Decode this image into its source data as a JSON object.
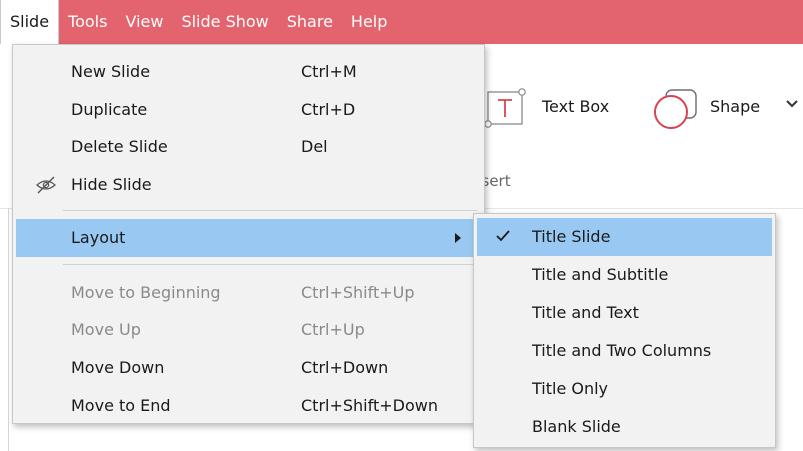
{
  "menubar": {
    "items": [
      {
        "label": "Slide",
        "active": true
      },
      {
        "label": "Tools"
      },
      {
        "label": "View"
      },
      {
        "label": "Slide Show"
      },
      {
        "label": "Share"
      },
      {
        "label": "Help"
      }
    ]
  },
  "ribbon": {
    "text_box_label": "Text Box",
    "shape_label": "Shape",
    "group_label": "nsert"
  },
  "slide_menu": {
    "items": [
      {
        "label": "New Slide",
        "shortcut": "Ctrl+M",
        "icon": "none"
      },
      {
        "label": "Duplicate",
        "shortcut": "Ctrl+D",
        "icon": "none"
      },
      {
        "label": "Delete Slide",
        "shortcut": "Del",
        "icon": "none"
      },
      {
        "label": "Hide Slide",
        "shortcut": "",
        "icon": "eye-slash-icon"
      },
      {
        "label": "Layout",
        "shortcut": "",
        "icon": "none",
        "has_submenu": true,
        "highlighted": true
      },
      {
        "label": "Move to Beginning",
        "shortcut": "Ctrl+Shift+Up",
        "disabled": true
      },
      {
        "label": "Move Up",
        "shortcut": "Ctrl+Up",
        "disabled": true
      },
      {
        "label": "Move Down",
        "shortcut": "Ctrl+Down"
      },
      {
        "label": "Move to End",
        "shortcut": "Ctrl+Shift+Down"
      }
    ]
  },
  "layout_submenu": {
    "items": [
      {
        "label": "Title Slide",
        "selected": true
      },
      {
        "label": "Title and Subtitle"
      },
      {
        "label": "Title and Text"
      },
      {
        "label": "Title and Two Columns"
      },
      {
        "label": "Title Only"
      },
      {
        "label": "Blank Slide"
      }
    ]
  },
  "colors": {
    "menubar_bg": "#e3636e",
    "highlight": "#99c9f3",
    "menu_bg": "#f2f2f2",
    "accent_red": "#d9434f"
  }
}
